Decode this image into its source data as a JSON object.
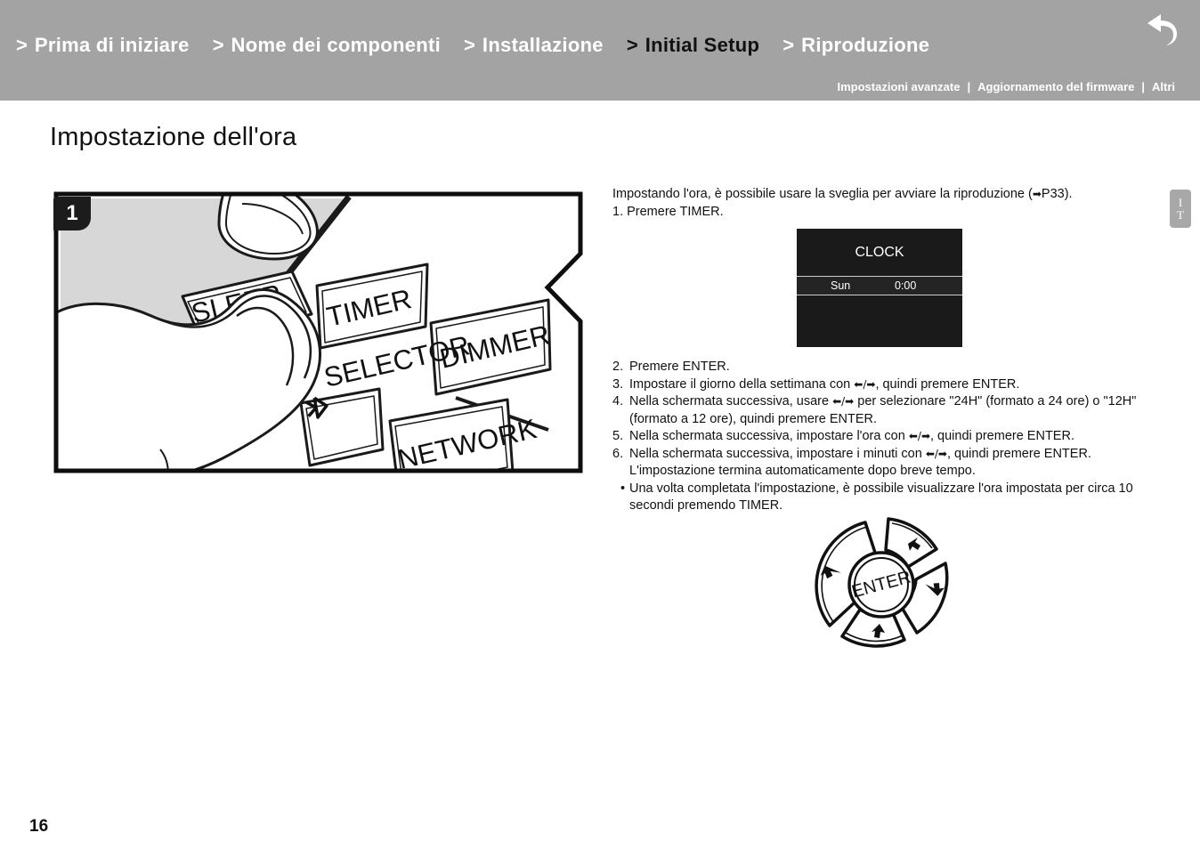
{
  "header": {
    "breadcrumbs": [
      {
        "chevron": ">",
        "label": "Prima di iniziare",
        "active": false
      },
      {
        "chevron": ">",
        "label": "Nome dei componenti",
        "active": false
      },
      {
        "chevron": ">",
        "label": "Installazione",
        "active": false
      },
      {
        "chevron": ">",
        "label": "Initial Setup",
        "active": true
      },
      {
        "chevron": ">",
        "label": "Riproduzione",
        "active": false
      }
    ],
    "subnav": [
      "Impostazioni avanzate",
      "Aggiornamento del firmware",
      "Altri"
    ],
    "subnav_separator": "|",
    "back_icon": "back-arrow-icon",
    "bar_color": "#a3a3a3"
  },
  "language_tab": {
    "line1": "I",
    "line2": "T"
  },
  "page": {
    "title": "Impostazione dell'ora",
    "number": "16"
  },
  "illustration": {
    "step_badge": "1",
    "caption_buttons": [
      "SLEEP",
      "TIMER",
      "DIMMER",
      "SELECTOR",
      "NETWORK"
    ],
    "bluetooth_icon": "bluetooth-icon"
  },
  "intro": {
    "line1_pre": "Impostando l'ora, è possibile usare la sveglia per avviare la riproduzione (",
    "line1_arrow": "➡",
    "line1_post": "P33).",
    "line2": "1. Premere TIMER."
  },
  "clock_display": {
    "title": "CLOCK",
    "day": "Sun",
    "time": "0:00",
    "bg_color": "#1a1a1a",
    "row_color": "#242424"
  },
  "steps": [
    {
      "num": "2.",
      "text": "Premere ENTER."
    },
    {
      "num": "3.",
      "text_pre": "Impostare il giorno della settimana con ",
      "arrows": "⬅/➡",
      "text_post": ", quindi premere ENTER."
    },
    {
      "num": "4.",
      "text_pre": "Nella schermata successiva, usare ",
      "arrows": "⬅/➡",
      "text_post": " per selezionare \"24H\" (formato a 24 ore) o \"12H\" (formato a 12 ore), quindi premere ENTER."
    },
    {
      "num": "5.",
      "text_pre": "Nella schermata successiva, impostare l'ora con ",
      "arrows": "⬅/➡",
      "text_post": ", quindi premere ENTER."
    },
    {
      "num": "6.",
      "text_pre": "Nella schermata successiva, impostare i minuti con ",
      "arrows": "⬅/➡",
      "text_post": ", quindi premere ENTER. L'impostazione termina automaticamente dopo breve tempo."
    }
  ],
  "note": {
    "dot": "•",
    "text": "Una volta completata l'impostazione, è possibile visualizzare l'ora impostata per circa 10 secondi premendo TIMER."
  },
  "wheel": {
    "center_label": "ENTER"
  }
}
